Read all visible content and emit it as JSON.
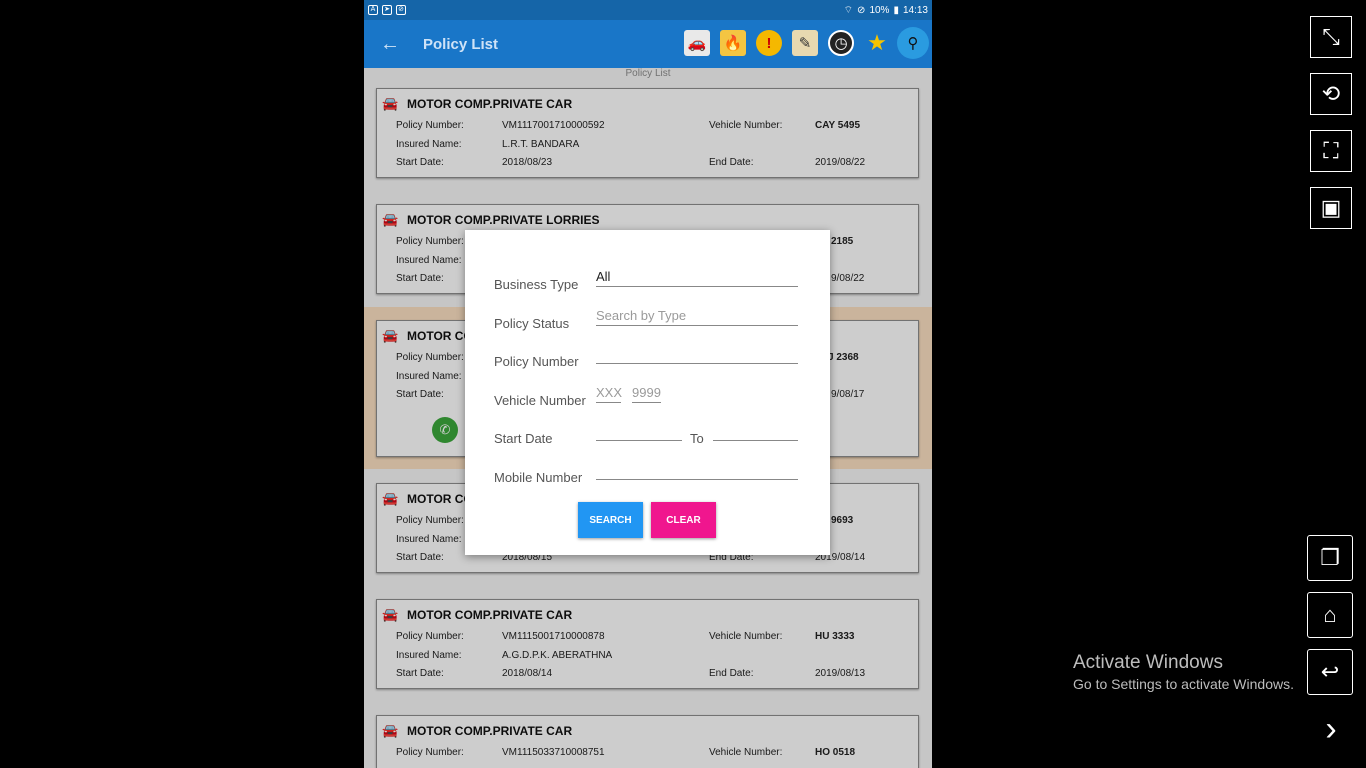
{
  "status_bar": {
    "battery": "10%",
    "time": "14:13"
  },
  "app_bar": {
    "title": "Policy List",
    "back_icon": "arrow-left-icon"
  },
  "toolbar_icons": [
    "car-icon",
    "fire-icon",
    "alert-icon",
    "edit-icon",
    "clock-icon",
    "star-icon",
    "search-icon"
  ],
  "list_caption": "Policy List",
  "labels": {
    "policy_number": "Policy Number:",
    "insured_name": "Insured Name:",
    "start_date": "Start Date:",
    "vehicle_number": "Vehicle Number:",
    "end_date": "End Date:"
  },
  "cards": [
    {
      "type": "MOTOR COMP.PRIVATE CAR",
      "policy_number": "VM1117001710000592",
      "vehicle_number": "CAY 5495",
      "insured_name": "L.R.T. BANDARA",
      "start_date": "2018/08/23",
      "end_date": "2019/08/22"
    },
    {
      "type": "MOTOR COMP.PRIVATE LORRIES",
      "policy_number": "",
      "vehicle_number": "2185",
      "insured_name": "",
      "start_date": "",
      "end_date": "9/08/22"
    },
    {
      "type": "MOTOR CO",
      "policy_number": "",
      "vehicle_number": "J 2368",
      "insured_name": "",
      "start_date": "",
      "end_date": "9/08/17"
    },
    {
      "type": "MOTOR CO",
      "policy_number": "",
      "vehicle_number": "9693",
      "insured_name": "",
      "start_date": "2018/08/15",
      "end_date": "2019/08/14"
    },
    {
      "type": "MOTOR COMP.PRIVATE CAR",
      "policy_number": "VM1115001710000878",
      "vehicle_number": "HU  3333",
      "insured_name": "A.G.D.P.K. ABERATHNA",
      "start_date": "2018/08/14",
      "end_date": "2019/08/13"
    },
    {
      "type": "MOTOR COMP.PRIVATE CAR",
      "policy_number": "VM1115033710008751",
      "vehicle_number": "HO  0518",
      "insured_name": "",
      "start_date": "",
      "end_date": ""
    }
  ],
  "dialog": {
    "business_type_label": "Business Type",
    "business_type_value": "All",
    "policy_status_label": "Policy Status",
    "policy_status_placeholder": "Search by Type",
    "policy_number_label": "Policy Number",
    "vehicle_number_label": "Vehicle Number",
    "vehicle_prefix_placeholder": "XXX",
    "vehicle_suffix_placeholder": "9999",
    "start_date_label": "Start Date",
    "to_label": "To",
    "mobile_number_label": "Mobile Number",
    "search_button": "SEARCH",
    "clear_button": "CLEAR"
  },
  "watermark": {
    "title": "Activate Windows",
    "subtitle": "Go to Settings to activate Windows."
  },
  "emulator_buttons": [
    "collapse-icon",
    "rotate-icon",
    "fullscreen-icon",
    "screenshot-icon",
    "recent-apps-icon",
    "home-icon",
    "back-icon",
    "chevron-right-icon"
  ]
}
